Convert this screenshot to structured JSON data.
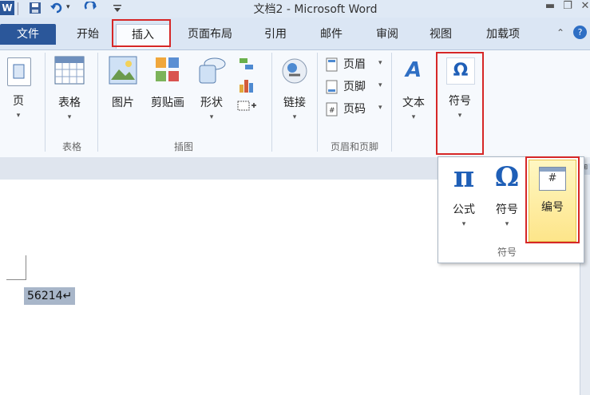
{
  "window": {
    "title": "文档2 - Microsoft Word",
    "app_icon": "W",
    "quick_access": [
      "save-icon",
      "undo-icon",
      "redo-icon",
      "customize-icon"
    ],
    "controls": [
      "minimize",
      "restore",
      "close"
    ]
  },
  "tabs": [
    {
      "label": "文件"
    },
    {
      "label": "开始"
    },
    {
      "label": "插入"
    },
    {
      "label": "页面布局"
    },
    {
      "label": "引用"
    },
    {
      "label": "邮件"
    },
    {
      "label": "审阅"
    },
    {
      "label": "视图"
    },
    {
      "label": "加载项"
    }
  ],
  "ribbon": {
    "page": {
      "label": "页",
      "arrow": "▾"
    },
    "table": {
      "label": "表格",
      "arrow": "▾",
      "group_label": "表格"
    },
    "illustrations": {
      "picture": "图片",
      "clipart": "剪贴画",
      "shapes": "形状",
      "shapes_arrow": "▾",
      "group_label": "插图"
    },
    "links": {
      "label": "链接",
      "arrow": "▾"
    },
    "header_footer": {
      "header": "页眉",
      "footer": "页脚",
      "page_number": "页码",
      "arrow": "▾",
      "group_label": "页眉和页脚"
    },
    "text": {
      "label": "文本",
      "arrow": "▾"
    },
    "symbols": {
      "label": "符号",
      "glyph": "Ω",
      "arrow": "▾"
    }
  },
  "dropdown": {
    "equation": {
      "label": "公式",
      "glyph": "π",
      "arrow": "▾"
    },
    "symbol": {
      "label": "符号",
      "glyph": "Ω",
      "arrow": "▾"
    },
    "numbering": {
      "label": "编号",
      "glyph": "#"
    },
    "group_label": "符号"
  },
  "document": {
    "selected_text": "56214↵"
  },
  "colors": {
    "highlight": "#d62727",
    "file_tab": "#2b579a",
    "ribbon_bg": "#f6f9fd"
  }
}
